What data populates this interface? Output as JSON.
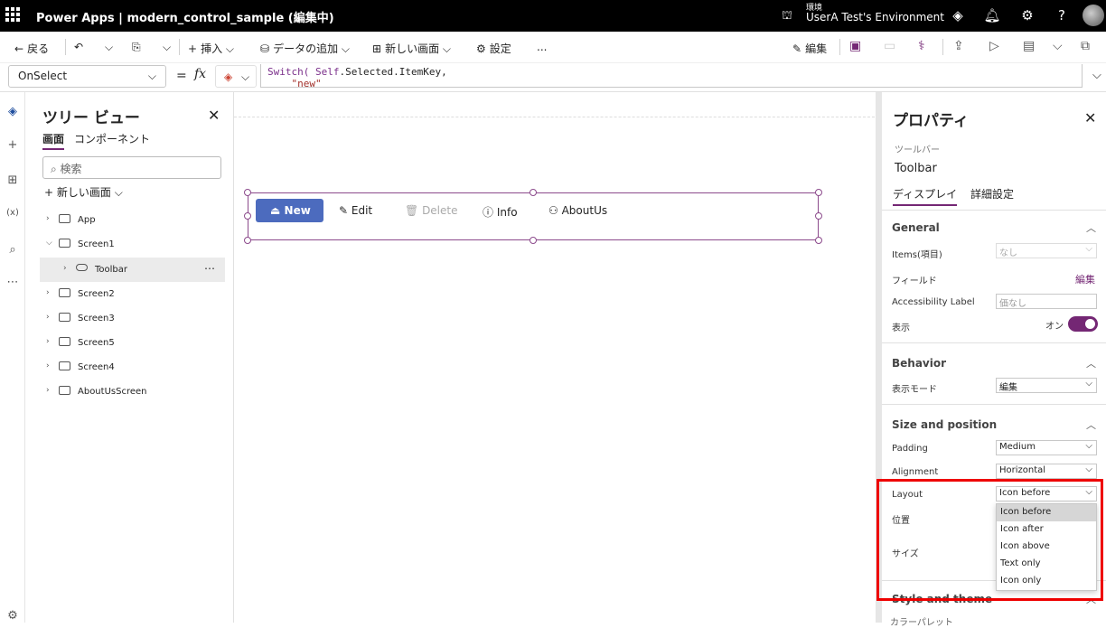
{
  "topbar": {
    "app": "Power Apps",
    "separator": "|",
    "doc_title": "modern_control_sample (編集中)",
    "env_label": "環境",
    "env_name": "UserA Test's Environment",
    "icons": [
      "copilot-icon",
      "bell-icon",
      "gear-icon",
      "help-icon"
    ]
  },
  "cmdbar": {
    "back": "戻る",
    "insert": "挿入",
    "add_data": "データの追加",
    "new_screen": "新しい画面",
    "settings": "設定",
    "more": "...",
    "edit": "編集"
  },
  "formula_bar": {
    "property": "OnSelect",
    "equals": "=",
    "fx": "fx",
    "line1_kw": "Switch(",
    "line1_self": " Self",
    "line1_rest": ".Selected.ItemKey,",
    "line2": "\"new\""
  },
  "tree": {
    "title": "ツリー ビュー",
    "tabs": [
      "画面",
      "コンポーネント"
    ],
    "search_placeholder": "検索",
    "new_screen": "新しい画面",
    "items": [
      {
        "label": "App"
      },
      {
        "label": "Screen1"
      },
      {
        "label": "Toolbar"
      },
      {
        "label": "Screen2"
      },
      {
        "label": "Screen3"
      },
      {
        "label": "Screen5"
      },
      {
        "label": "Screen4"
      },
      {
        "label": "AboutUsScreen"
      }
    ],
    "more": "⋯"
  },
  "toolbar_control": {
    "buttons": [
      {
        "label": "New",
        "icon": "eject-icon"
      },
      {
        "label": "Edit",
        "icon": "pencil-icon"
      },
      {
        "label": "Delete",
        "icon": "trash-icon"
      },
      {
        "label": "Info",
        "icon": "info-icon"
      },
      {
        "label": "AboutUs",
        "icon": "people-icon"
      }
    ]
  },
  "properties": {
    "title": "プロパティ",
    "control_type": "ツールバー",
    "control_name": "Toolbar",
    "tabs": [
      "ディスプレイ",
      "詳細設定"
    ],
    "general": {
      "title": "General",
      "items_label": "Items(項目)",
      "items_value": "なし",
      "fields_label": "フィールド",
      "fields_action": "編集",
      "access_label": "Accessibility Label",
      "access_placeholder": "価なし",
      "visible_label": "表示",
      "visible_value": "オン",
      "visible_on": true
    },
    "behavior": {
      "title": "Behavior",
      "mode_label": "表示モード",
      "mode_value": "編集"
    },
    "size": {
      "title": "Size and position",
      "padding_label": "Padding",
      "padding_value": "Medium",
      "align_label": "Alignment",
      "align_value": "Horizontal",
      "layout_label": "Layout",
      "layout_value": "Icon before",
      "position_label": "位置",
      "size_label": "サイズ"
    },
    "style": {
      "title": "Style and theme",
      "color_label": "カラーパレット"
    }
  },
  "layout_dropdown": {
    "options": [
      "Icon before",
      "Icon after",
      "Icon above",
      "Text only",
      "Icon only"
    ],
    "selected": "Icon before"
  },
  "colors": {
    "accent": "#742774",
    "primary_button": "#4c6bbe",
    "highlight": "#e00000"
  }
}
